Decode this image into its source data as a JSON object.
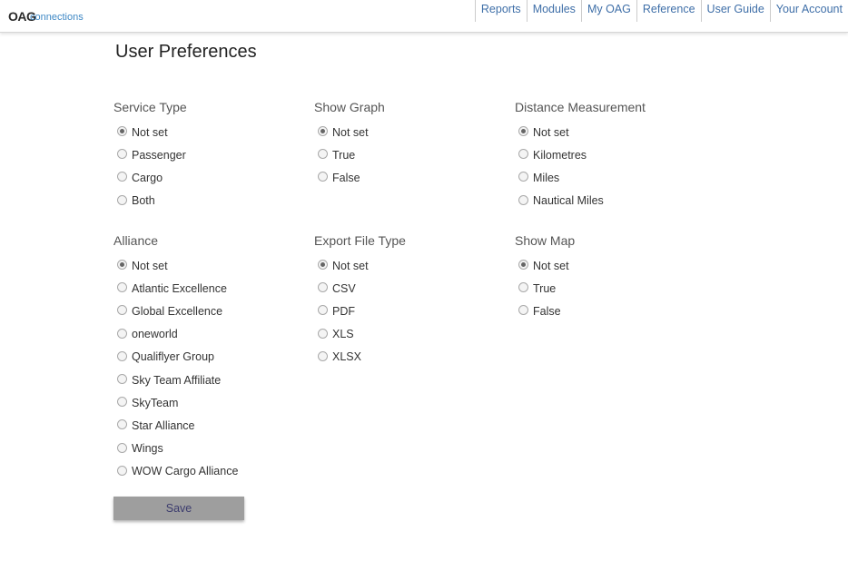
{
  "logo": {
    "brand": "OAG",
    "suffix": "connections"
  },
  "nav": [
    "Reports",
    "Modules",
    "My OAG",
    "Reference",
    "User Guide",
    "Your Account"
  ],
  "page_title": "User Preferences",
  "groups": {
    "service_type": {
      "title": "Service Type",
      "options": [
        "Not set",
        "Passenger",
        "Cargo",
        "Both"
      ],
      "selected": "Not set"
    },
    "show_graph": {
      "title": "Show Graph",
      "options": [
        "Not set",
        "True",
        "False"
      ],
      "selected": "Not set"
    },
    "distance": {
      "title": "Distance Measurement",
      "options": [
        "Not set",
        "Kilometres",
        "Miles",
        "Nautical Miles"
      ],
      "selected": "Not set"
    },
    "alliance": {
      "title": "Alliance",
      "options": [
        "Not set",
        "Atlantic Excellence",
        "Global Excellence",
        "oneworld",
        "Qualiflyer Group",
        "Sky Team Affiliate",
        "SkyTeam",
        "Star Alliance",
        "Wings",
        "WOW Cargo Alliance"
      ],
      "selected": "Not set"
    },
    "export_type": {
      "title": "Export File Type",
      "options": [
        "Not set",
        "CSV",
        "PDF",
        "XLS",
        "XLSX"
      ],
      "selected": "Not set"
    },
    "show_map": {
      "title": "Show Map",
      "options": [
        "Not set",
        "True",
        "False"
      ],
      "selected": "Not set"
    }
  },
  "save_label": "Save"
}
